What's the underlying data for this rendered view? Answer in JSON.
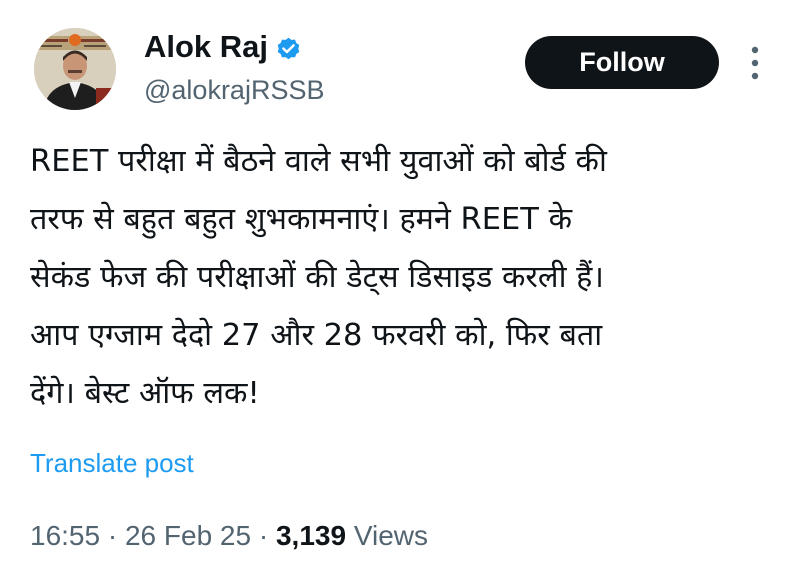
{
  "author": {
    "display_name": "Alok Raj",
    "handle": "@alokrajRSSB",
    "verified": true,
    "avatar_icon": "profile-photo",
    "verified_icon": "verified-badge-icon",
    "verified_color": "#1d9bf0"
  },
  "actions": {
    "follow_label": "Follow",
    "more_icon": "more-options-icon"
  },
  "tweet": {
    "lines": [
      "REET परीक्षा में बैठने वाले सभी युवाओं को बोर्ड की",
      "तरफ से बहुत बहुत शुभकामनाएं। हमने REET के",
      "सेकंड फेज की परीक्षाओं की डेट्स डिसाइड करली हैं।",
      "आप एग्जाम देदो 27 और 28 फरवरी को, फिर बता",
      "देंगे। बेस्ट ऑफ लक!"
    ],
    "translate_label": "Translate post"
  },
  "meta": {
    "time": "16:55",
    "date": "26 Feb 25",
    "views_count": "3,139",
    "views_label": "Views",
    "separator": "·"
  },
  "colors": {
    "text": "#0f1419",
    "secondary": "#536471",
    "link": "#1d9bf0",
    "button_bg": "#0f1419",
    "button_text": "#ffffff"
  }
}
